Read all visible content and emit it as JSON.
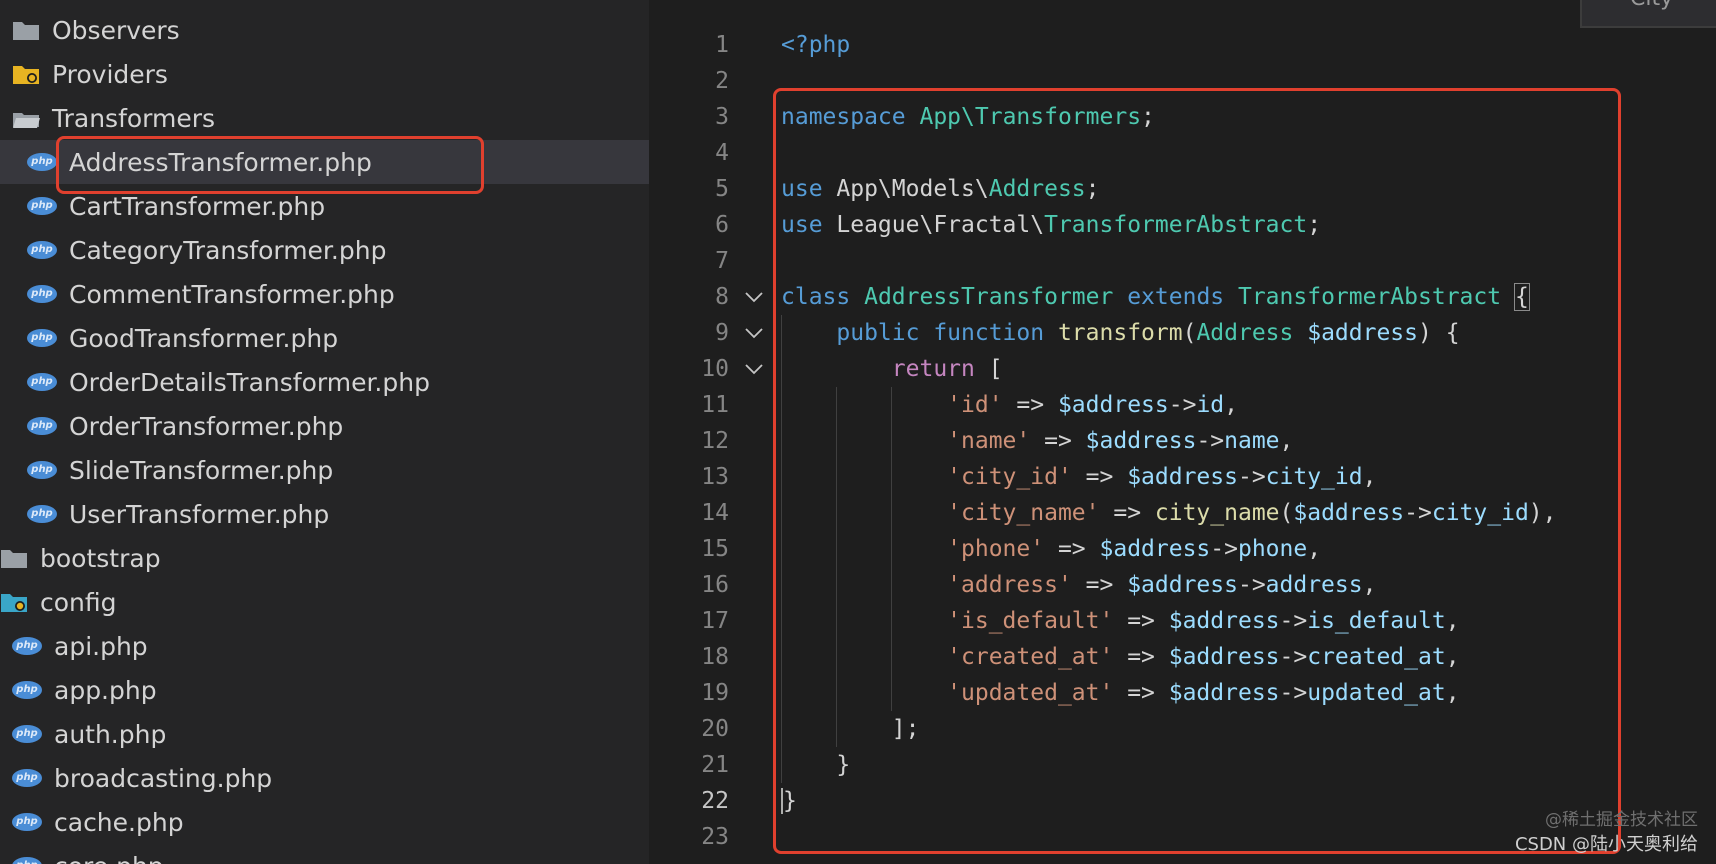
{
  "explorer": {
    "items": [
      {
        "label": "Observers",
        "icon": "folder-icon"
      },
      {
        "label": "Providers",
        "icon": "folder-gear-icon"
      },
      {
        "label": "Transformers",
        "icon": "folder-open-icon"
      },
      {
        "label": "AddressTransformer.php",
        "icon": "php-file-icon",
        "selected": true
      },
      {
        "label": "CartTransformer.php",
        "icon": "php-file-icon"
      },
      {
        "label": "CategoryTransformer.php",
        "icon": "php-file-icon"
      },
      {
        "label": "CommentTransformer.php",
        "icon": "php-file-icon"
      },
      {
        "label": "GoodTransformer.php",
        "icon": "php-file-icon"
      },
      {
        "label": "OrderDetailsTransformer.php",
        "icon": "php-file-icon"
      },
      {
        "label": "OrderTransformer.php",
        "icon": "php-file-icon"
      },
      {
        "label": "SlideTransformer.php",
        "icon": "php-file-icon"
      },
      {
        "label": "UserTransformer.php",
        "icon": "php-file-icon"
      },
      {
        "label": "bootstrap",
        "icon": "folder-icon"
      },
      {
        "label": "config",
        "icon": "folder-gear-icon"
      },
      {
        "label": "api.php",
        "icon": "php-file-icon"
      },
      {
        "label": "app.php",
        "icon": "php-file-icon"
      },
      {
        "label": "auth.php",
        "icon": "php-file-icon"
      },
      {
        "label": "broadcasting.php",
        "icon": "php-file-icon"
      },
      {
        "label": "cache.php",
        "icon": "php-file-icon"
      },
      {
        "label": "core.php",
        "icon": "php-file-icon"
      }
    ],
    "php_badge": "php"
  },
  "editor": {
    "active_line": 22,
    "lines": [
      {
        "n": "1",
        "tokens": [
          [
            "t-tag",
            "<?php"
          ]
        ]
      },
      {
        "n": "2",
        "tokens": []
      },
      {
        "n": "3",
        "tokens": [
          [
            "t-kw",
            "namespace "
          ],
          [
            "t-cls",
            "App\\Transformers"
          ],
          [
            "t-op",
            ";"
          ]
        ]
      },
      {
        "n": "4",
        "tokens": []
      },
      {
        "n": "5",
        "tokens": [
          [
            "t-kw",
            "use "
          ],
          [
            "t-op",
            "App\\Models\\"
          ],
          [
            "t-cls",
            "Address"
          ],
          [
            "t-op",
            ";"
          ]
        ]
      },
      {
        "n": "6",
        "tokens": [
          [
            "t-kw",
            "use "
          ],
          [
            "t-op",
            "League\\Fractal\\"
          ],
          [
            "t-cls",
            "TransformerAbstract"
          ],
          [
            "t-op",
            ";"
          ]
        ]
      },
      {
        "n": "7",
        "tokens": []
      },
      {
        "n": "8",
        "fold": true,
        "tokens": [
          [
            "t-kw",
            "class "
          ],
          [
            "t-cls",
            "AddressTransformer "
          ],
          [
            "t-kw",
            "extends "
          ],
          [
            "t-cls",
            "TransformerAbstract "
          ],
          [
            "t-op bracket-box",
            "{"
          ]
        ]
      },
      {
        "n": "9",
        "fold": true,
        "tokens": [
          [
            "t-op",
            "    "
          ],
          [
            "t-kw",
            "public function "
          ],
          [
            "t-fn",
            "transform"
          ],
          [
            "t-op",
            "("
          ],
          [
            "t-cls",
            "Address "
          ],
          [
            "t-var",
            "$address"
          ],
          [
            "t-op",
            ") {"
          ]
        ]
      },
      {
        "n": "10",
        "fold": true,
        "tokens": [
          [
            "t-op",
            "        "
          ],
          [
            "t-ctl",
            "return "
          ],
          [
            "t-op",
            "["
          ]
        ]
      },
      {
        "n": "11",
        "tokens": [
          [
            "t-op",
            "            "
          ],
          [
            "t-str",
            "'id'"
          ],
          [
            "t-op",
            " => "
          ],
          [
            "t-var",
            "$address"
          ],
          [
            "t-op",
            "->"
          ],
          [
            "t-var",
            "id"
          ],
          [
            "t-op",
            ","
          ]
        ]
      },
      {
        "n": "12",
        "tokens": [
          [
            "t-op",
            "            "
          ],
          [
            "t-str",
            "'name'"
          ],
          [
            "t-op",
            " => "
          ],
          [
            "t-var",
            "$address"
          ],
          [
            "t-op",
            "->"
          ],
          [
            "t-var",
            "name"
          ],
          [
            "t-op",
            ","
          ]
        ]
      },
      {
        "n": "13",
        "tokens": [
          [
            "t-op",
            "            "
          ],
          [
            "t-str",
            "'city_id'"
          ],
          [
            "t-op",
            " => "
          ],
          [
            "t-var",
            "$address"
          ],
          [
            "t-op",
            "->"
          ],
          [
            "t-var",
            "city_id"
          ],
          [
            "t-op",
            ","
          ]
        ]
      },
      {
        "n": "14",
        "tokens": [
          [
            "t-op",
            "            "
          ],
          [
            "t-str",
            "'city_name'"
          ],
          [
            "t-op",
            " => "
          ],
          [
            "t-fn",
            "city_name"
          ],
          [
            "t-op",
            "("
          ],
          [
            "t-var",
            "$address"
          ],
          [
            "t-op",
            "->"
          ],
          [
            "t-var",
            "city_id"
          ],
          [
            "t-op",
            "),"
          ]
        ]
      },
      {
        "n": "15",
        "tokens": [
          [
            "t-op",
            "            "
          ],
          [
            "t-str",
            "'phone'"
          ],
          [
            "t-op",
            " => "
          ],
          [
            "t-var",
            "$address"
          ],
          [
            "t-op",
            "->"
          ],
          [
            "t-var",
            "phone"
          ],
          [
            "t-op",
            ","
          ]
        ]
      },
      {
        "n": "16",
        "tokens": [
          [
            "t-op",
            "            "
          ],
          [
            "t-str",
            "'address'"
          ],
          [
            "t-op",
            " => "
          ],
          [
            "t-var",
            "$address"
          ],
          [
            "t-op",
            "->"
          ],
          [
            "t-var",
            "address"
          ],
          [
            "t-op",
            ","
          ]
        ]
      },
      {
        "n": "17",
        "tokens": [
          [
            "t-op",
            "            "
          ],
          [
            "t-str",
            "'is_default'"
          ],
          [
            "t-op",
            " => "
          ],
          [
            "t-var",
            "$address"
          ],
          [
            "t-op",
            "->"
          ],
          [
            "t-var",
            "is_default"
          ],
          [
            "t-op",
            ","
          ]
        ]
      },
      {
        "n": "18",
        "tokens": [
          [
            "t-op",
            "            "
          ],
          [
            "t-str",
            "'created_at'"
          ],
          [
            "t-op",
            " => "
          ],
          [
            "t-var",
            "$address"
          ],
          [
            "t-op",
            "->"
          ],
          [
            "t-var",
            "created_at"
          ],
          [
            "t-op",
            ","
          ]
        ]
      },
      {
        "n": "19",
        "tokens": [
          [
            "t-op",
            "            "
          ],
          [
            "t-str",
            "'updated_at'"
          ],
          [
            "t-op",
            " => "
          ],
          [
            "t-var",
            "$address"
          ],
          [
            "t-op",
            "->"
          ],
          [
            "t-var",
            "updated_at"
          ],
          [
            "t-op",
            ","
          ]
        ]
      },
      {
        "n": "20",
        "tokens": [
          [
            "t-op",
            "        ];"
          ]
        ]
      },
      {
        "n": "21",
        "tokens": [
          [
            "t-op",
            "    }"
          ]
        ]
      },
      {
        "n": "22",
        "tokens": [
          [
            "t-op cursor-char",
            "}"
          ]
        ]
      },
      {
        "n": "23",
        "tokens": []
      }
    ]
  },
  "top_widget": {
    "label": "City"
  },
  "watermark": {
    "line1": "@稀土掘金技术社区",
    "line2": "CSDN @陆小天奥利给"
  },
  "colors": {
    "highlight_border": "#e0402e",
    "php_badge": "#4a8dd6",
    "folder": "#9aa0a6",
    "folder_special": "#e8b422",
    "folder_config": "#3aa6c8"
  }
}
